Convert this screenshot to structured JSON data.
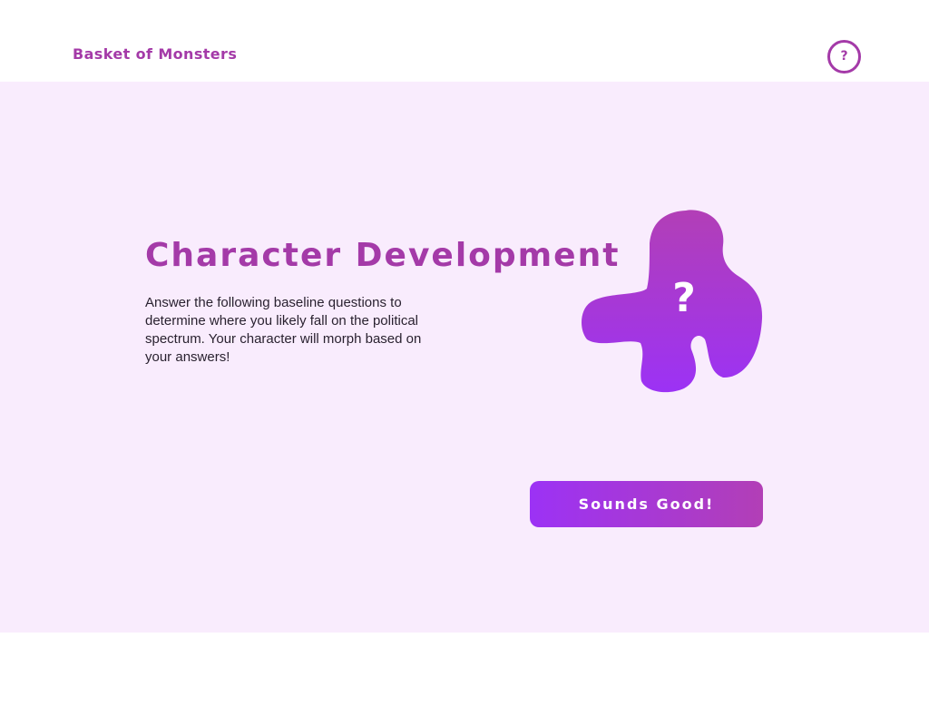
{
  "app": {
    "title": "Basket of Monsters",
    "help_label": "?"
  },
  "intro": {
    "heading": "Character Development",
    "description": "Answer the following baseline questions to determine where you likely fall on the political spectrum.  Your character will morph based on your answers!",
    "monster_mark": "?",
    "cta_label": "Sounds Good!"
  },
  "colors": {
    "brand": "#a43aa8",
    "background_tint": "#f9ecfd",
    "gradient_start": "#9c32f5",
    "gradient_end": "#b23fb6"
  },
  "icons": {
    "help": "help-circle-icon",
    "monster": "mystery-monster-blob"
  }
}
